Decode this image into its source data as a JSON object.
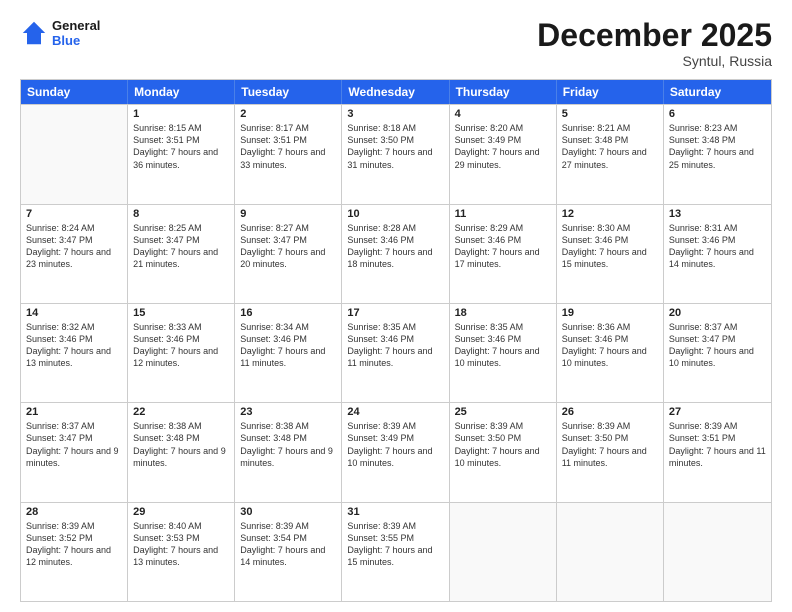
{
  "logo": {
    "line1": "General",
    "line2": "Blue"
  },
  "title": "December 2025",
  "location": "Syntul, Russia",
  "days": [
    "Sunday",
    "Monday",
    "Tuesday",
    "Wednesday",
    "Thursday",
    "Friday",
    "Saturday"
  ],
  "weeks": [
    [
      {
        "day": "",
        "sunrise": "",
        "sunset": "",
        "daylight": ""
      },
      {
        "day": "1",
        "sunrise": "Sunrise: 8:15 AM",
        "sunset": "Sunset: 3:51 PM",
        "daylight": "Daylight: 7 hours and 36 minutes."
      },
      {
        "day": "2",
        "sunrise": "Sunrise: 8:17 AM",
        "sunset": "Sunset: 3:51 PM",
        "daylight": "Daylight: 7 hours and 33 minutes."
      },
      {
        "day": "3",
        "sunrise": "Sunrise: 8:18 AM",
        "sunset": "Sunset: 3:50 PM",
        "daylight": "Daylight: 7 hours and 31 minutes."
      },
      {
        "day": "4",
        "sunrise": "Sunrise: 8:20 AM",
        "sunset": "Sunset: 3:49 PM",
        "daylight": "Daylight: 7 hours and 29 minutes."
      },
      {
        "day": "5",
        "sunrise": "Sunrise: 8:21 AM",
        "sunset": "Sunset: 3:48 PM",
        "daylight": "Daylight: 7 hours and 27 minutes."
      },
      {
        "day": "6",
        "sunrise": "Sunrise: 8:23 AM",
        "sunset": "Sunset: 3:48 PM",
        "daylight": "Daylight: 7 hours and 25 minutes."
      }
    ],
    [
      {
        "day": "7",
        "sunrise": "Sunrise: 8:24 AM",
        "sunset": "Sunset: 3:47 PM",
        "daylight": "Daylight: 7 hours and 23 minutes."
      },
      {
        "day": "8",
        "sunrise": "Sunrise: 8:25 AM",
        "sunset": "Sunset: 3:47 PM",
        "daylight": "Daylight: 7 hours and 21 minutes."
      },
      {
        "day": "9",
        "sunrise": "Sunrise: 8:27 AM",
        "sunset": "Sunset: 3:47 PM",
        "daylight": "Daylight: 7 hours and 20 minutes."
      },
      {
        "day": "10",
        "sunrise": "Sunrise: 8:28 AM",
        "sunset": "Sunset: 3:46 PM",
        "daylight": "Daylight: 7 hours and 18 minutes."
      },
      {
        "day": "11",
        "sunrise": "Sunrise: 8:29 AM",
        "sunset": "Sunset: 3:46 PM",
        "daylight": "Daylight: 7 hours and 17 minutes."
      },
      {
        "day": "12",
        "sunrise": "Sunrise: 8:30 AM",
        "sunset": "Sunset: 3:46 PM",
        "daylight": "Daylight: 7 hours and 15 minutes."
      },
      {
        "day": "13",
        "sunrise": "Sunrise: 8:31 AM",
        "sunset": "Sunset: 3:46 PM",
        "daylight": "Daylight: 7 hours and 14 minutes."
      }
    ],
    [
      {
        "day": "14",
        "sunrise": "Sunrise: 8:32 AM",
        "sunset": "Sunset: 3:46 PM",
        "daylight": "Daylight: 7 hours and 13 minutes."
      },
      {
        "day": "15",
        "sunrise": "Sunrise: 8:33 AM",
        "sunset": "Sunset: 3:46 PM",
        "daylight": "Daylight: 7 hours and 12 minutes."
      },
      {
        "day": "16",
        "sunrise": "Sunrise: 8:34 AM",
        "sunset": "Sunset: 3:46 PM",
        "daylight": "Daylight: 7 hours and 11 minutes."
      },
      {
        "day": "17",
        "sunrise": "Sunrise: 8:35 AM",
        "sunset": "Sunset: 3:46 PM",
        "daylight": "Daylight: 7 hours and 11 minutes."
      },
      {
        "day": "18",
        "sunrise": "Sunrise: 8:35 AM",
        "sunset": "Sunset: 3:46 PM",
        "daylight": "Daylight: 7 hours and 10 minutes."
      },
      {
        "day": "19",
        "sunrise": "Sunrise: 8:36 AM",
        "sunset": "Sunset: 3:46 PM",
        "daylight": "Daylight: 7 hours and 10 minutes."
      },
      {
        "day": "20",
        "sunrise": "Sunrise: 8:37 AM",
        "sunset": "Sunset: 3:47 PM",
        "daylight": "Daylight: 7 hours and 10 minutes."
      }
    ],
    [
      {
        "day": "21",
        "sunrise": "Sunrise: 8:37 AM",
        "sunset": "Sunset: 3:47 PM",
        "daylight": "Daylight: 7 hours and 9 minutes."
      },
      {
        "day": "22",
        "sunrise": "Sunrise: 8:38 AM",
        "sunset": "Sunset: 3:48 PM",
        "daylight": "Daylight: 7 hours and 9 minutes."
      },
      {
        "day": "23",
        "sunrise": "Sunrise: 8:38 AM",
        "sunset": "Sunset: 3:48 PM",
        "daylight": "Daylight: 7 hours and 9 minutes."
      },
      {
        "day": "24",
        "sunrise": "Sunrise: 8:39 AM",
        "sunset": "Sunset: 3:49 PM",
        "daylight": "Daylight: 7 hours and 10 minutes."
      },
      {
        "day": "25",
        "sunrise": "Sunrise: 8:39 AM",
        "sunset": "Sunset: 3:50 PM",
        "daylight": "Daylight: 7 hours and 10 minutes."
      },
      {
        "day": "26",
        "sunrise": "Sunrise: 8:39 AM",
        "sunset": "Sunset: 3:50 PM",
        "daylight": "Daylight: 7 hours and 11 minutes."
      },
      {
        "day": "27",
        "sunrise": "Sunrise: 8:39 AM",
        "sunset": "Sunset: 3:51 PM",
        "daylight": "Daylight: 7 hours and 11 minutes."
      }
    ],
    [
      {
        "day": "28",
        "sunrise": "Sunrise: 8:39 AM",
        "sunset": "Sunset: 3:52 PM",
        "daylight": "Daylight: 7 hours and 12 minutes."
      },
      {
        "day": "29",
        "sunrise": "Sunrise: 8:40 AM",
        "sunset": "Sunset: 3:53 PM",
        "daylight": "Daylight: 7 hours and 13 minutes."
      },
      {
        "day": "30",
        "sunrise": "Sunrise: 8:39 AM",
        "sunset": "Sunset: 3:54 PM",
        "daylight": "Daylight: 7 hours and 14 minutes."
      },
      {
        "day": "31",
        "sunrise": "Sunrise: 8:39 AM",
        "sunset": "Sunset: 3:55 PM",
        "daylight": "Daylight: 7 hours and 15 minutes."
      },
      {
        "day": "",
        "sunrise": "",
        "sunset": "",
        "daylight": ""
      },
      {
        "day": "",
        "sunrise": "",
        "sunset": "",
        "daylight": ""
      },
      {
        "day": "",
        "sunrise": "",
        "sunset": "",
        "daylight": ""
      }
    ]
  ]
}
